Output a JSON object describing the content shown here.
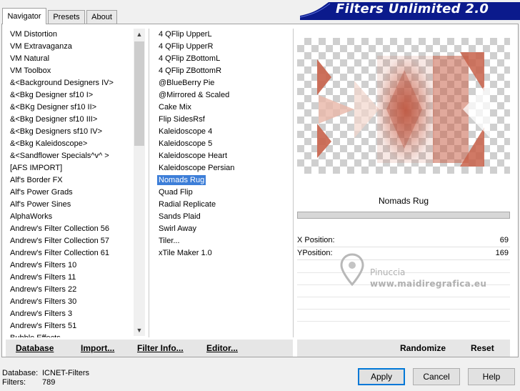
{
  "tabs": [
    "Navigator",
    "Presets",
    "About"
  ],
  "brand": {
    "title": "Filters Unlimited 2.0",
    "color": "#0b1a8c"
  },
  "categories": {
    "items": [
      "VM Distortion",
      "VM Extravaganza",
      "VM Natural",
      "VM Toolbox",
      "&<Background Designers IV>",
      "&<Bkg Designer sf10 I>",
      "&<BKg Designer sf10 II>",
      "&<Bkg Designer sf10 III>",
      "&<Bkg Designers sf10 IV>",
      "&<Bkg Kaleidoscope>",
      "&<Sandflower Specials^v^ >",
      "[AFS IMPORT]",
      "Alf's Border FX",
      "Alf's Power Grads",
      "Alf's Power Sines",
      "AlphaWorks",
      "Andrew's Filter Collection 56",
      "Andrew's Filter Collection 57",
      "Andrew's Filter Collection 61",
      "Andrew's Filters 10",
      "Andrew's Filters 11",
      "Andrew's Filters 22",
      "Andrew's Filters 30",
      "Andrew's Filters 3",
      "Andrew's Filters 51",
      "Bubble Effects"
    ]
  },
  "filters": {
    "items": [
      "4 QFlip UpperL",
      "4 QFlip UpperR",
      "4 QFlip ZBottomL",
      "4 QFlip ZBottomR",
      "@BlueBerry Pie",
      "@Mirrored & Scaled",
      "Cake Mix",
      "Flip SidesRsf",
      "Kaleidoscope 4",
      "Kaleidoscope 5",
      "Kaleidoscope Heart",
      "Kaleidoscope Persian",
      "Nomads Rug",
      "Quad Flip",
      "Radial Replicate",
      "Sands Plaid",
      "Swirl Away",
      "Tiler...",
      "xTile Maker 1.0"
    ],
    "selected": "Nomads Rug"
  },
  "left_buttons": {
    "database": "Database",
    "import": "Import...",
    "filter_info": "Filter Info...",
    "editor": "Editor..."
  },
  "filter_name": "Nomads Rug",
  "params": [
    {
      "label": "X Position:",
      "value": "69"
    },
    {
      "label": "YPosition:",
      "value": "169"
    }
  ],
  "watermark": {
    "name": "Pinuccia",
    "url": "www.maidiregrafica.eu"
  },
  "right_buttons": {
    "randomize": "Randomize",
    "reset": "Reset"
  },
  "status": {
    "database_label": "Database:",
    "database_value": "ICNET-Filters",
    "filters_label": "Filters:",
    "filters_value": "789"
  },
  "dialog_buttons": {
    "apply": "Apply",
    "cancel": "Cancel",
    "help": "Help"
  },
  "colors": {
    "selection": "#3d7ed8",
    "preview_tile": "#c8624a",
    "focus_border": "#0078d7"
  }
}
